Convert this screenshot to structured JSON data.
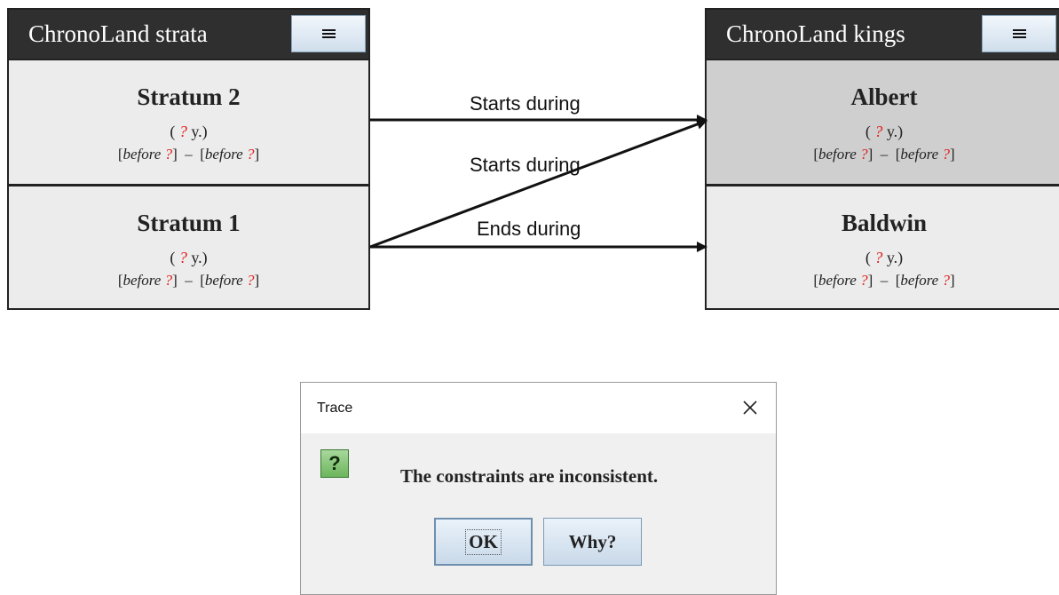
{
  "left_panel": {
    "title": "ChronoLand strata",
    "entries": [
      {
        "name": "Stratum 2",
        "duration_prefix": "(",
        "duration_value": "?",
        "duration_suffix": "y.)",
        "range_open": "[",
        "range_word": "before",
        "range_value": "?",
        "range_close": "]",
        "range_sep": "–"
      },
      {
        "name": "Stratum 1",
        "duration_prefix": "(",
        "duration_value": "?",
        "duration_suffix": "y.)",
        "range_open": "[",
        "range_word": "before",
        "range_value": "?",
        "range_close": "]",
        "range_sep": "–"
      }
    ]
  },
  "right_panel": {
    "title": "ChronoLand kings",
    "entries": [
      {
        "name": "Albert",
        "selected": true,
        "duration_prefix": "(",
        "duration_value": "?",
        "duration_suffix": "y.)",
        "range_open": "[",
        "range_word": "before",
        "range_value": "?",
        "range_close": "]",
        "range_sep": "–"
      },
      {
        "name": "Baldwin",
        "selected": false,
        "duration_prefix": "(",
        "duration_value": "?",
        "duration_suffix": "y.)",
        "range_open": "[",
        "range_word": "before",
        "range_value": "?",
        "range_close": "]",
        "range_sep": "–"
      }
    ]
  },
  "relations": [
    {
      "label": "Starts during",
      "from": "Stratum 2",
      "to": "Albert"
    },
    {
      "label": "Starts during",
      "from": "Stratum 1",
      "to": "Albert"
    },
    {
      "label": "Ends during",
      "from": "Stratum 1",
      "to": "Baldwin"
    }
  ],
  "dialog": {
    "title": "Trace",
    "icon": "question-icon",
    "icon_glyph": "?",
    "message": "The constraints are inconsistent.",
    "ok_label": "OK",
    "why_label": "Why?"
  },
  "colors": {
    "header_bg": "#2f2f2f",
    "entry_bg": "#ececec",
    "selected_bg": "#cfcfcf",
    "unknown_value": "#e02020",
    "icon_green": "#6cb55d"
  }
}
